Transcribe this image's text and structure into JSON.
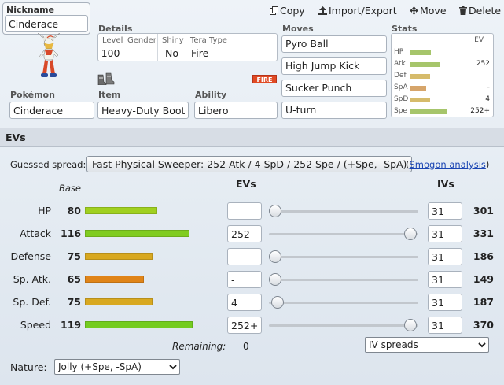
{
  "toolbar": {
    "copy": "Copy",
    "import_export": "Import/Export",
    "move": "Move",
    "delete": "Delete"
  },
  "nickname": {
    "label": "Nickname",
    "value": "Cinderace"
  },
  "details": {
    "section_label": "Details",
    "level_label": "Level",
    "level": "100",
    "gender_label": "Gender",
    "gender": "—",
    "shiny_label": "Shiny",
    "shiny": "No",
    "tera_label": "Tera Type",
    "tera": "Fire",
    "tera_badge": "FIRE"
  },
  "pokemon": {
    "label": "Pokémon",
    "value": "Cinderace"
  },
  "item": {
    "label": "Item",
    "value": "Heavy-Duty Boots"
  },
  "ability": {
    "label": "Ability",
    "value": "Libero"
  },
  "moves": {
    "label": "Moves",
    "list": [
      "Pyro Ball",
      "High Jump Kick",
      "Sucker Punch",
      "U-turn"
    ]
  },
  "stats_summary": {
    "label": "Stats",
    "ev_header": "EV",
    "rows": [
      {
        "name": "HP",
        "ev": "",
        "bar_fraction": 0.42,
        "color": "#a6c56b"
      },
      {
        "name": "Atk",
        "ev": "252",
        "bar_fraction": 0.62,
        "color": "#a6c56b"
      },
      {
        "name": "Def",
        "ev": "",
        "bar_fraction": 0.4,
        "color": "#d6bb6b"
      },
      {
        "name": "SpA",
        "ev": "–",
        "bar_fraction": 0.33,
        "color": "#d6a56b"
      },
      {
        "name": "SpD",
        "ev": "4",
        "bar_fraction": 0.4,
        "color": "#d6bb6b"
      },
      {
        "name": "Spe",
        "ev": "252+",
        "bar_fraction": 0.75,
        "color": "#a6c56b"
      }
    ]
  },
  "evs_section": {
    "title": "EVs",
    "guessed_label": "Guessed spread:",
    "guessed_value": "Fast Physical Sweeper: 252 Atk / 4 SpD / 252 Spe / (+Spe, -SpA)",
    "paren_open": "(",
    "smogon_link": "Smogon analysis",
    "paren_close": ")",
    "base_header": "Base",
    "evs_header": "EVs",
    "ivs_header": "IVs",
    "remaining_label": "Remaining:",
    "remaining_value": "0",
    "iv_spreads_select": "IV spreads",
    "nature_label": "Nature:",
    "nature_value": "Jolly (+Spe, -SpA)"
  },
  "stat_rows": [
    {
      "label": "HP",
      "base": "80",
      "base_num": 80,
      "color": "#a0d020",
      "ev": "",
      "ev_num": 0,
      "iv": "31",
      "final": "301"
    },
    {
      "label": "Attack",
      "base": "116",
      "base_num": 116,
      "color": "#80cc20",
      "ev": "252",
      "ev_num": 252,
      "iv": "31",
      "final": "331"
    },
    {
      "label": "Defense",
      "base": "75",
      "base_num": 75,
      "color": "#d8a820",
      "ev": "",
      "ev_num": 0,
      "iv": "31",
      "final": "186"
    },
    {
      "label": "Sp. Atk.",
      "base": "65",
      "base_num": 65,
      "color": "#e08418",
      "ev": "-",
      "ev_num": 0,
      "iv": "31",
      "final": "149"
    },
    {
      "label": "Sp. Def.",
      "base": "75",
      "base_num": 75,
      "color": "#d8a820",
      "ev": "4",
      "ev_num": 4,
      "iv": "31",
      "final": "187"
    },
    {
      "label": "Speed",
      "base": "119",
      "base_num": 119,
      "color": "#74cc20",
      "ev": "252+",
      "ev_num": 252,
      "iv": "31",
      "final": "370"
    }
  ]
}
